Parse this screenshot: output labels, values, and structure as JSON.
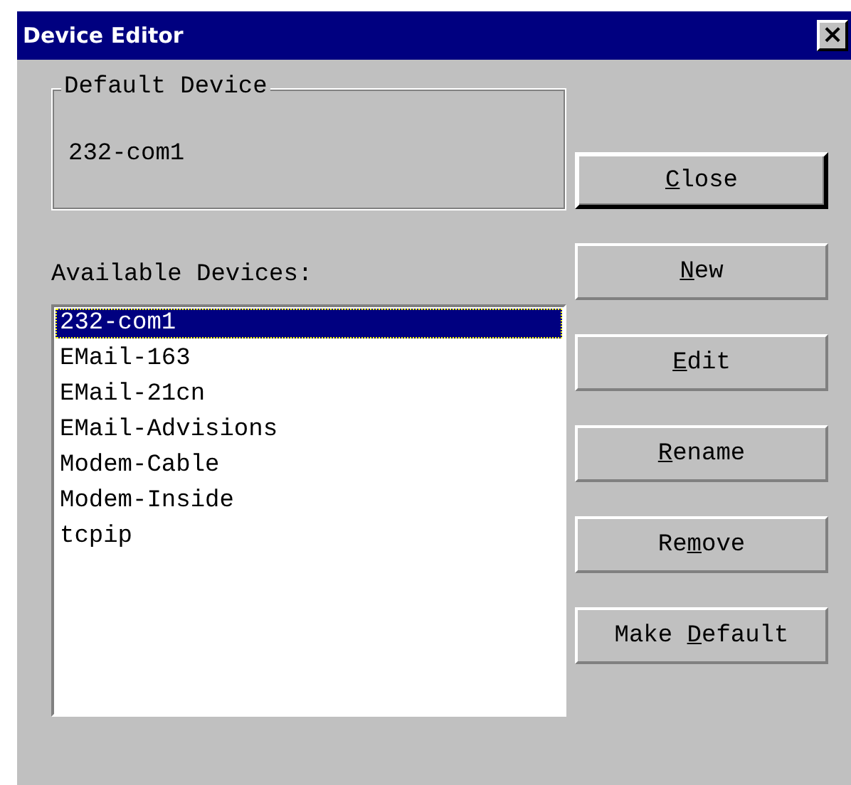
{
  "window": {
    "title": "Device Editor",
    "close_glyph": "×"
  },
  "default_device": {
    "legend": "Default Device",
    "value": "232-com1"
  },
  "available_label": "Available Devices:",
  "devices": [
    {
      "name": "232-com1",
      "selected": true
    },
    {
      "name": "EMail-163",
      "selected": false
    },
    {
      "name": "EMail-21cn",
      "selected": false
    },
    {
      "name": "EMail-Advisions",
      "selected": false
    },
    {
      "name": "Modem-Cable",
      "selected": false
    },
    {
      "name": "Modem-Inside",
      "selected": false
    },
    {
      "name": "tcpip",
      "selected": false
    }
  ],
  "buttons": [
    {
      "kind": "default",
      "parts": [
        {
          "text": "C",
          "underlined": true
        },
        {
          "text": "lose",
          "underlined": false
        }
      ]
    },
    {
      "kind": "normal",
      "parts": [
        {
          "text": "N",
          "underlined": true
        },
        {
          "text": "ew",
          "underlined": false
        }
      ]
    },
    {
      "kind": "normal",
      "parts": [
        {
          "text": "E",
          "underlined": true
        },
        {
          "text": "dit",
          "underlined": false
        }
      ]
    },
    {
      "kind": "normal",
      "parts": [
        {
          "text": "R",
          "underlined": true
        },
        {
          "text": "ename",
          "underlined": false
        }
      ]
    },
    {
      "kind": "normal",
      "parts": [
        {
          "text": "Re",
          "underlined": false
        },
        {
          "text": "m",
          "underlined": true
        },
        {
          "text": "ove",
          "underlined": false
        }
      ]
    },
    {
      "kind": "normal",
      "parts": [
        {
          "text": "Make ",
          "underlined": false
        },
        {
          "text": "D",
          "underlined": true
        },
        {
          "text": "efault",
          "underlined": false
        }
      ]
    }
  ]
}
